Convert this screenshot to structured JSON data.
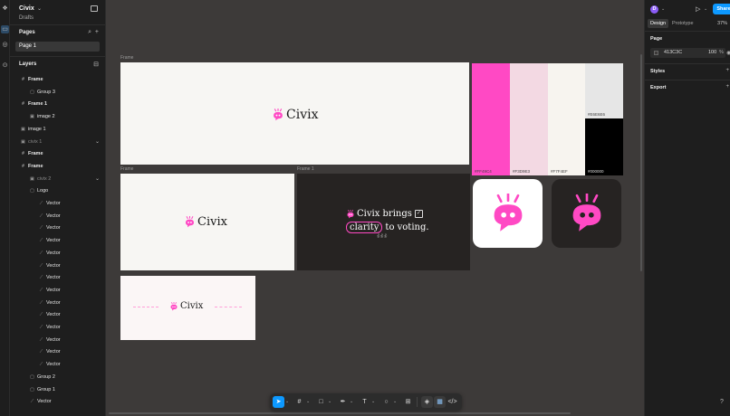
{
  "file": {
    "title": "Civix",
    "location": "Drafts"
  },
  "left_panel": {
    "pages_title": "Pages",
    "pages": [
      {
        "label": "Page 1"
      }
    ],
    "layers_title": "Layers",
    "layers": [
      {
        "label": "Frame",
        "indent": 0,
        "icon": "frame-icon",
        "bold": true
      },
      {
        "label": "Group 3",
        "indent": 1,
        "icon": "group-icon"
      },
      {
        "label": "Frame 1",
        "indent": 0,
        "icon": "frame-icon",
        "bold": true
      },
      {
        "label": "image 2",
        "indent": 1,
        "icon": "image-icon"
      },
      {
        "label": "image 1",
        "indent": 0,
        "icon": "image-icon"
      },
      {
        "label": "civix 1",
        "indent": 0,
        "icon": "image-icon",
        "dim": true,
        "expanded": true
      },
      {
        "label": "Frame",
        "indent": 0,
        "icon": "frame-icon",
        "bold": true
      },
      {
        "label": "Frame",
        "indent": 0,
        "icon": "frame-icon",
        "bold": true
      },
      {
        "label": "civix 2",
        "indent": 1,
        "icon": "image-icon",
        "dim": true,
        "expanded": true
      },
      {
        "label": "Logo",
        "indent": 1,
        "icon": "group-icon"
      },
      {
        "label": "Vector",
        "indent": 2,
        "icon": "vector-icon"
      },
      {
        "label": "Vector",
        "indent": 2,
        "icon": "vector-icon"
      },
      {
        "label": "Vector",
        "indent": 2,
        "icon": "vector-icon"
      },
      {
        "label": "Vector",
        "indent": 2,
        "icon": "vector-icon"
      },
      {
        "label": "Vector",
        "indent": 2,
        "icon": "vector-icon"
      },
      {
        "label": "Vector",
        "indent": 2,
        "icon": "vector-icon"
      },
      {
        "label": "Vector",
        "indent": 2,
        "icon": "vector-icon"
      },
      {
        "label": "Vector",
        "indent": 2,
        "icon": "vector-icon"
      },
      {
        "label": "Vector",
        "indent": 2,
        "icon": "vector-icon"
      },
      {
        "label": "Vector",
        "indent": 2,
        "icon": "vector-icon"
      },
      {
        "label": "Vector",
        "indent": 2,
        "icon": "vector-icon"
      },
      {
        "label": "Vector",
        "indent": 2,
        "icon": "vector-icon"
      },
      {
        "label": "Vector",
        "indent": 2,
        "icon": "vector-icon"
      },
      {
        "label": "Vector",
        "indent": 2,
        "icon": "vector-icon"
      },
      {
        "label": "Group 2",
        "indent": 1,
        "icon": "group-icon"
      },
      {
        "label": "Group 1",
        "indent": 1,
        "icon": "group-icon"
      },
      {
        "label": "Vector",
        "indent": 1,
        "icon": "vector-icon"
      }
    ]
  },
  "right_panel": {
    "avatar_letter": "D",
    "share_label": "Share",
    "tabs": {
      "design": "Design",
      "prototype": "Prototype"
    },
    "zoom": "37%",
    "page_section": "Page",
    "page_color_hex": "413C3C",
    "page_opacity": "100",
    "page_opacity_unit": "%",
    "styles_section": "Styles",
    "export_section": "Export",
    "help": "?"
  },
  "canvas": {
    "frame_labels": [
      "Frame",
      "Frame",
      "Frame 1"
    ],
    "brand_name": "Civix",
    "tagline": {
      "prefix": "Civix brings",
      "highlight": "clarity",
      "suffix": "to voting."
    },
    "palette": [
      {
        "hex": "#FF49C4",
        "color": "#ff49c4"
      },
      {
        "hex": "#F3D9E3",
        "color": "#f3d9e3"
      },
      {
        "hex": "#F7F4EF",
        "color": "#f7f4ef"
      },
      {
        "hex": "#E6E6E6",
        "color": "#e6e6e6"
      },
      {
        "hex": "#000000",
        "color": "#000000"
      }
    ],
    "colors": {
      "brand_pink": "#ff49c4",
      "dark_frame": "#262322",
      "light_frame": "#f7f6f3",
      "blush_frame": "#fbf6f6"
    }
  },
  "toolbar": {
    "tools": [
      "move-tool",
      "frame-tool",
      "shape-tool",
      "pen-tool",
      "text-tool",
      "comment-tool",
      "actions-tool",
      "dev-mode",
      "design-mode",
      "code-view"
    ]
  }
}
